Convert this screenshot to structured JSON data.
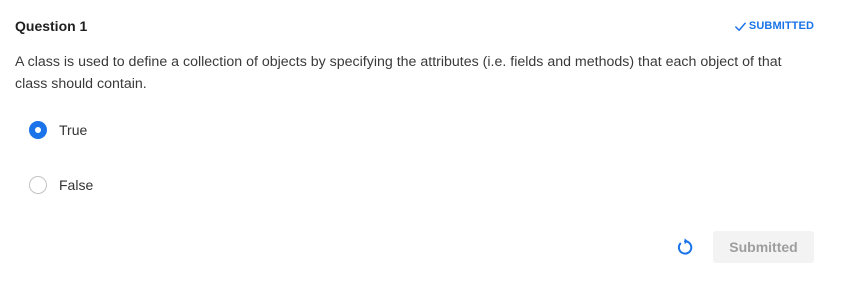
{
  "question": {
    "title": "Question 1",
    "status": "SUBMITTED",
    "text": "A class is used to define a collection of objects by specifying the attributes (i.e. fields and methods) that each object of that class should contain.",
    "options": [
      {
        "label": "True",
        "selected": true
      },
      {
        "label": "False",
        "selected": false
      }
    ]
  },
  "footer": {
    "retry_icon": "retry-icon",
    "submit_label": "Submitted"
  },
  "colors": {
    "accent": "#1a73e8",
    "disabled_bg": "#f3f3f3",
    "disabled_text": "#9e9e9e"
  }
}
